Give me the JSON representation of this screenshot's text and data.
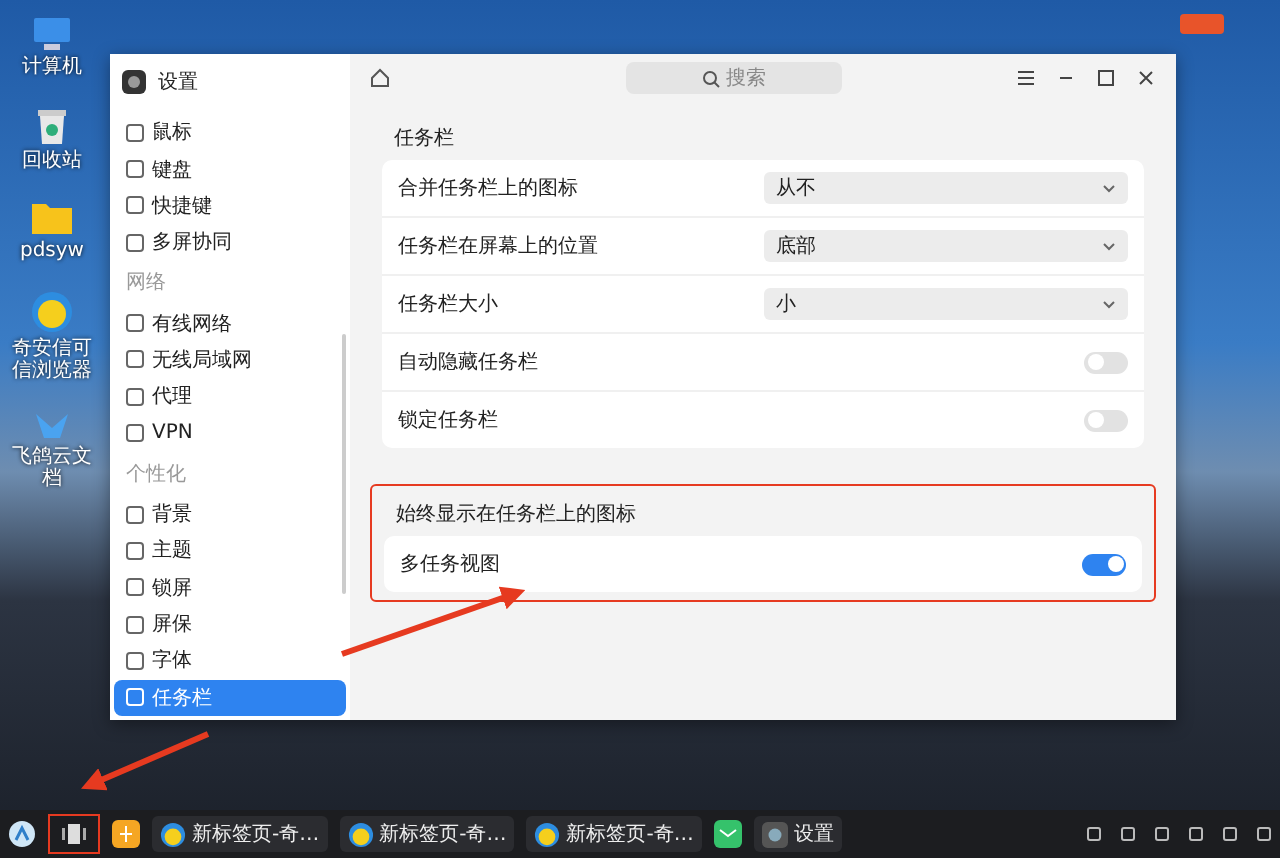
{
  "desktop_icons": [
    {
      "label": "计算机",
      "kind": "monitor"
    },
    {
      "label": "回收站",
      "kind": "trash"
    },
    {
      "label": "pdsyw",
      "kind": "folder"
    },
    {
      "label": "奇安信可信浏览器",
      "kind": "browser"
    },
    {
      "label": "飞鸽云文档",
      "kind": "doc"
    }
  ],
  "window": {
    "title": "设置",
    "search": {
      "placeholder": "搜索"
    }
  },
  "sidebar": {
    "sections": [
      {
        "items": [
          {
            "label": "鼠标",
            "selected": false
          },
          {
            "label": "键盘",
            "selected": false
          },
          {
            "label": "快捷键",
            "selected": false
          },
          {
            "label": "多屏协同",
            "selected": false
          }
        ]
      },
      {
        "title": "网络",
        "items": [
          {
            "label": "有线网络",
            "selected": false
          },
          {
            "label": "无线局域网",
            "selected": false
          },
          {
            "label": "代理",
            "selected": false
          },
          {
            "label": "VPN",
            "selected": false
          }
        ]
      },
      {
        "title": "个性化",
        "items": [
          {
            "label": "背景",
            "selected": false
          },
          {
            "label": "主题",
            "selected": false
          },
          {
            "label": "锁屏",
            "selected": false
          },
          {
            "label": "屏保",
            "selected": false
          },
          {
            "label": "字体",
            "selected": false
          },
          {
            "label": "任务栏",
            "selected": true
          }
        ]
      }
    ]
  },
  "groups": [
    {
      "title": "任务栏",
      "highlighted": false,
      "rows": [
        {
          "label": "合并任务栏上的图标",
          "kind": "select",
          "value": "从不"
        },
        {
          "label": "任务栏在屏幕上的位置",
          "kind": "select",
          "value": "底部"
        },
        {
          "label": "任务栏大小",
          "kind": "select",
          "value": "小"
        },
        {
          "label": "自动隐藏任务栏",
          "kind": "toggle",
          "on": false
        },
        {
          "label": "锁定任务栏",
          "kind": "toggle",
          "on": false
        }
      ]
    },
    {
      "title": "始终显示在任务栏上的图标",
      "highlighted": true,
      "rows": [
        {
          "label": "多任务视图",
          "kind": "toggle",
          "on": true
        }
      ]
    }
  ],
  "taskbar": {
    "tasks": [
      {
        "label": "新标签页-奇…",
        "kind": "browser"
      },
      {
        "label": "新标签页-奇…",
        "kind": "browser"
      },
      {
        "label": "新标签页-奇…",
        "kind": "browser"
      },
      {
        "kind": "chat"
      },
      {
        "label": "设置",
        "kind": "settings"
      }
    ]
  }
}
